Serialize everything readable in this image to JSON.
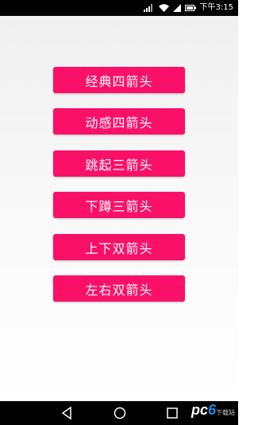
{
  "status_bar": {
    "time": "下午3:15",
    "icons": [
      "signal-strength-icon",
      "wifi-icon",
      "cellular-icon",
      "battery-icon"
    ]
  },
  "buttons": [
    {
      "label": "经典四箭头"
    },
    {
      "label": "动感四箭头"
    },
    {
      "label": "跳起三箭头"
    },
    {
      "label": "下蹲三箭头"
    },
    {
      "label": "上下双箭头"
    },
    {
      "label": "左右双箭头"
    }
  ],
  "theme": {
    "button_color": "#fb1068",
    "button_text_color": "#ffffff"
  },
  "nav_bar": {
    "icons": [
      "back-icon",
      "home-icon",
      "recents-icon"
    ]
  },
  "watermark": {
    "text_pre": "pc",
    "text_num": "6",
    "text_suffix": "下载站"
  }
}
